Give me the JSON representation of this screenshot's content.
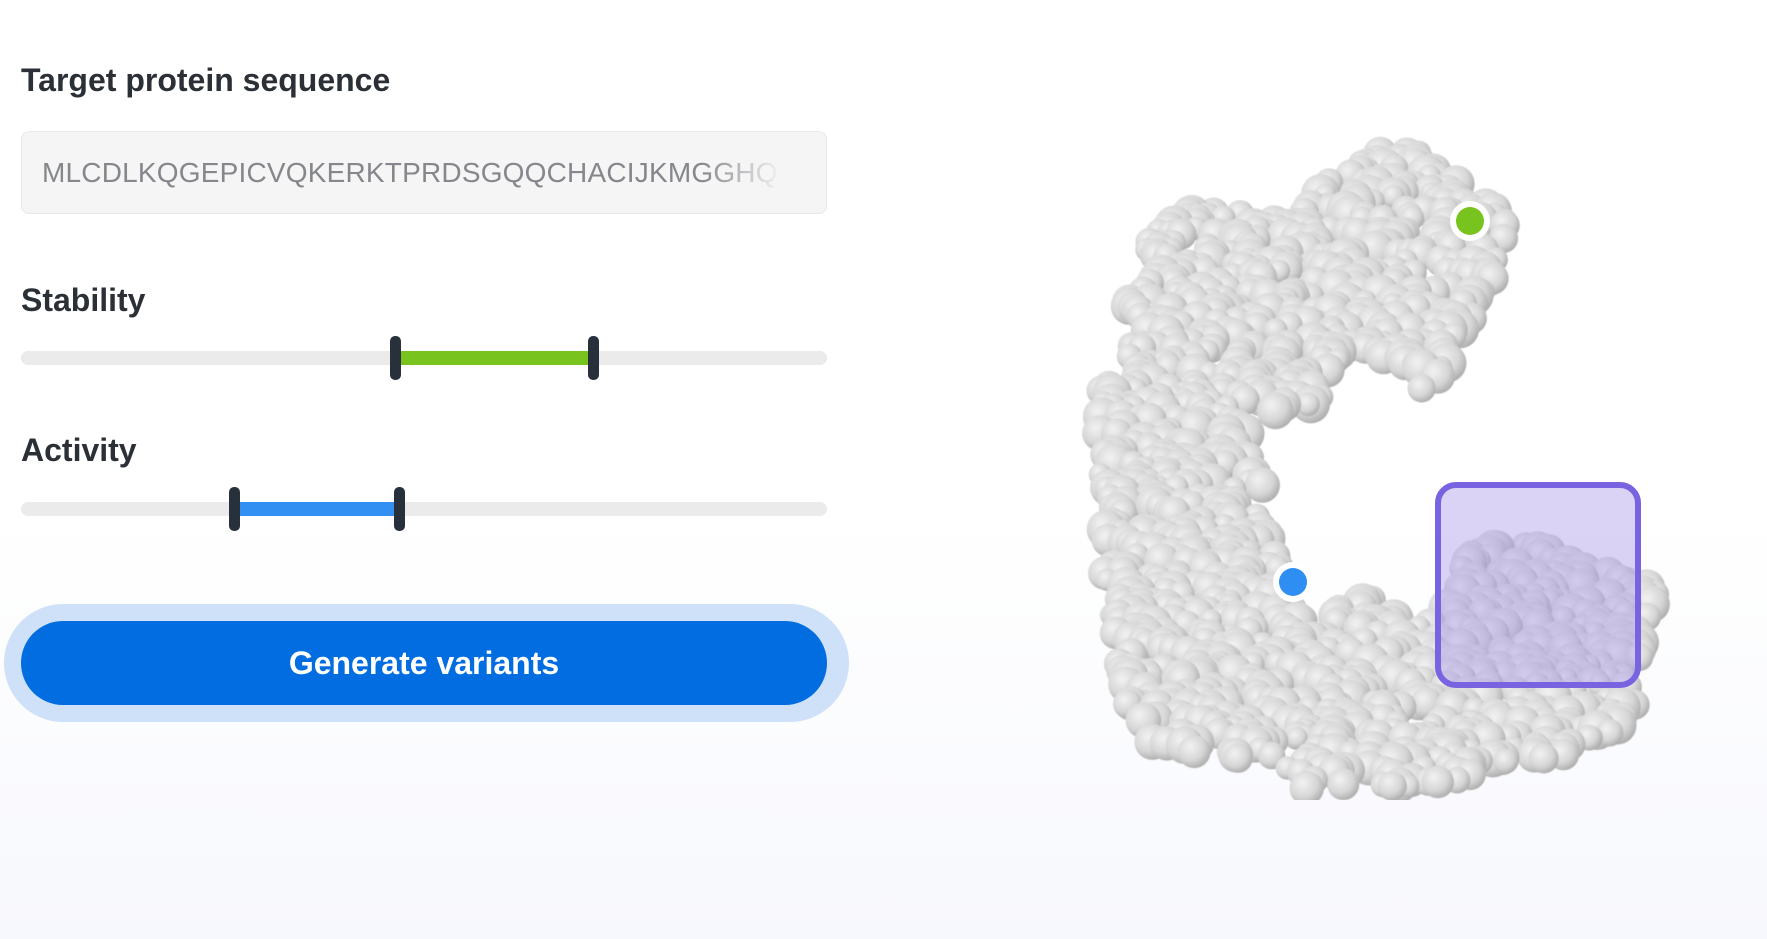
{
  "form": {
    "sequence_label": "Target protein sequence",
    "sequence_value": "MLCDLKQGEPICVQKERKTPRDSGQQCHACIJKMGGHQ",
    "stability": {
      "label": "Stability",
      "range_low": 0.465,
      "range_high": 0.71,
      "color": "#78c31d"
    },
    "activity": {
      "label": "Activity",
      "range_low": 0.265,
      "range_high": 0.47,
      "color": "#3190f2"
    },
    "generate_button_label": "Generate variants"
  },
  "structure_view": {
    "markers": [
      {
        "name": "stability-site-marker",
        "color": "#78c31d"
      },
      {
        "name": "activity-site-marker",
        "color": "#2f8ef1"
      }
    ],
    "selection_color": "#7a63e0"
  }
}
